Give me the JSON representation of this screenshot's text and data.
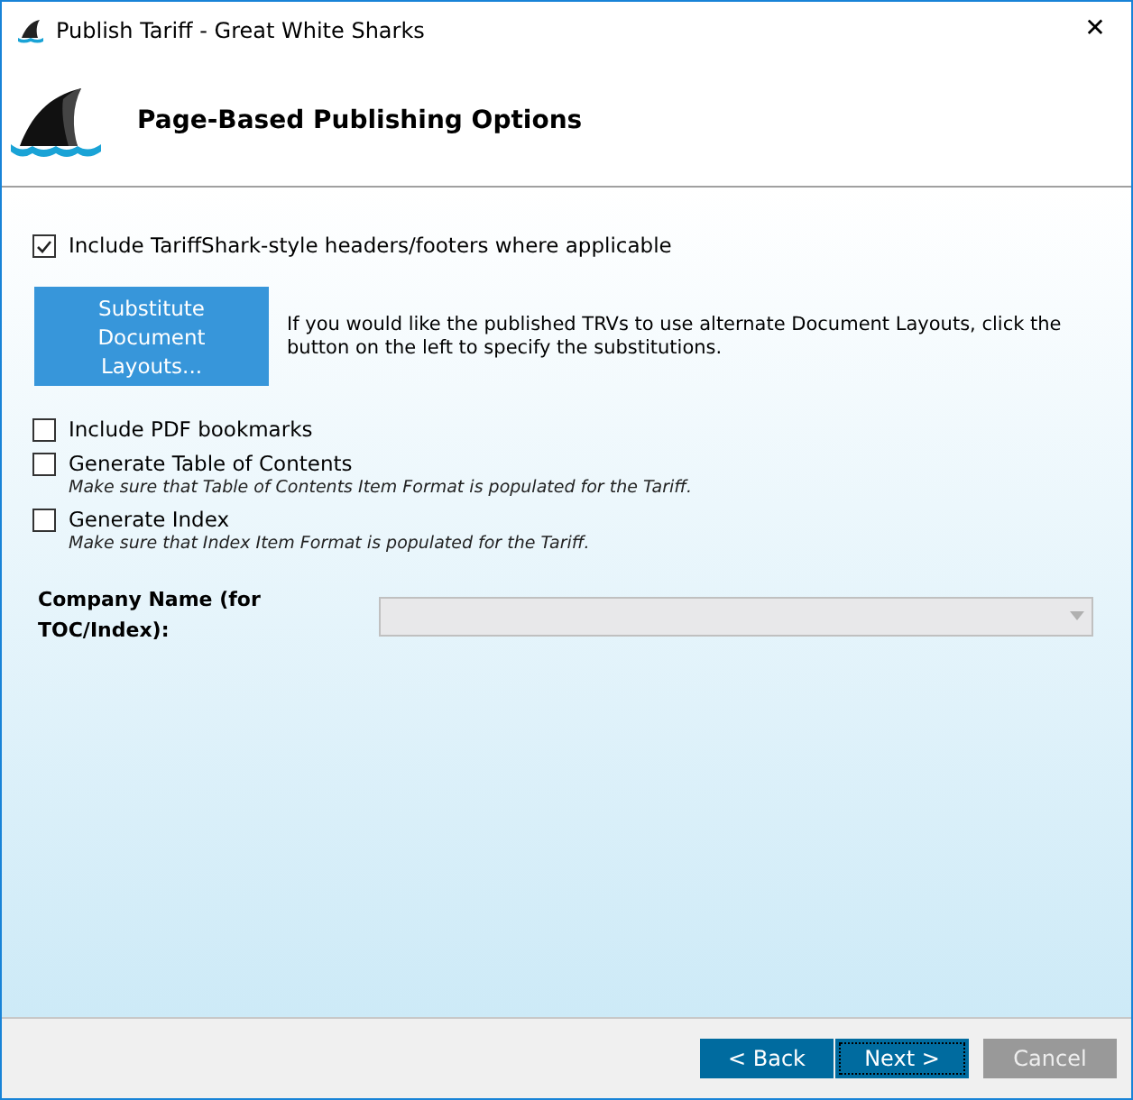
{
  "window": {
    "title": "Publish Tariff - Great White Sharks",
    "close": "✕"
  },
  "header": {
    "title": "Page-Based Publishing Options"
  },
  "options": [
    {
      "kind": "checkbox",
      "label": "Include TariffShark-style headers/footers where applicable",
      "checked": true
    },
    {
      "kind": "action",
      "button": "Substitute Document Layouts...",
      "description": "If you would like the published TRVs to use alternate Document Layouts, click the button on the left to specify the substitutions."
    },
    {
      "kind": "checkbox",
      "label": "Include PDF bookmarks",
      "checked": false
    },
    {
      "kind": "checkbox",
      "label": "Generate Table of Contents",
      "hint": "Make sure that Table of Contents Item Format is populated for the Tariff.",
      "checked": false
    },
    {
      "kind": "checkbox",
      "label": "Generate Index",
      "hint": "Make sure that Index Item Format is populated for the Tariff.",
      "checked": false
    }
  ],
  "company": {
    "label": "Company Name (for TOC/Index):",
    "disabled": true
  },
  "buttons": [
    {
      "label": "< Back",
      "disabled": false,
      "focused": false
    },
    {
      "label": "Next >",
      "disabled": false,
      "focused": true
    },
    {
      "label": "Cancel",
      "disabled": true,
      "focused": false
    }
  ]
}
